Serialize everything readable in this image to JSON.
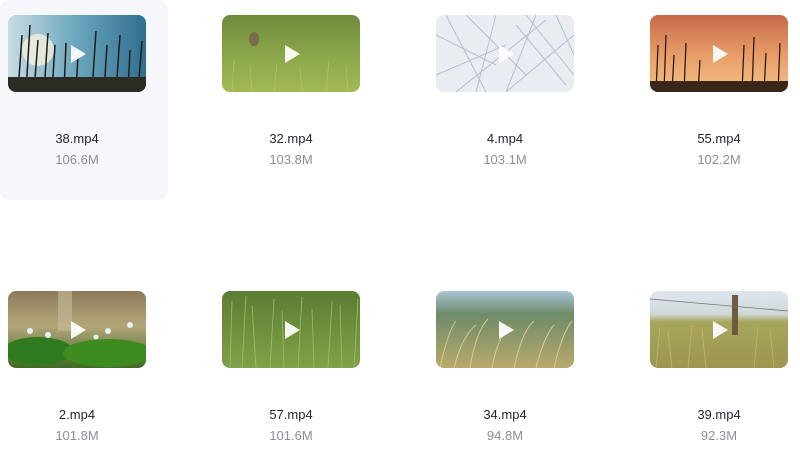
{
  "videos": [
    {
      "name": "38.mp4",
      "size": "106.6M",
      "thumb": "grass-sky-silhouette",
      "selected": true
    },
    {
      "name": "32.mp4",
      "size": "103.8M",
      "thumb": "green-field-deer",
      "selected": false
    },
    {
      "name": "4.mp4",
      "size": "103.1M",
      "thumb": "frosted-grass",
      "selected": false
    },
    {
      "name": "55.mp4",
      "size": "102.2M",
      "thumb": "sunset-grass-silhouette",
      "selected": false
    },
    {
      "name": "2.mp4",
      "size": "101.8M",
      "thumb": "forest-flowers",
      "selected": false
    },
    {
      "name": "57.mp4",
      "size": "101.6M",
      "thumb": "tall-green-grass",
      "selected": false
    },
    {
      "name": "34.mp4",
      "size": "94.8M",
      "thumb": "golden-grass-hills",
      "selected": false
    },
    {
      "name": "39.mp4",
      "size": "92.3M",
      "thumb": "fence-meadow",
      "selected": false
    }
  ],
  "icons": {
    "play": "play-icon"
  },
  "colors": {
    "selected_bg": "#f5f7fb",
    "name_text": "#1f2430",
    "size_text": "#8a8f99"
  }
}
